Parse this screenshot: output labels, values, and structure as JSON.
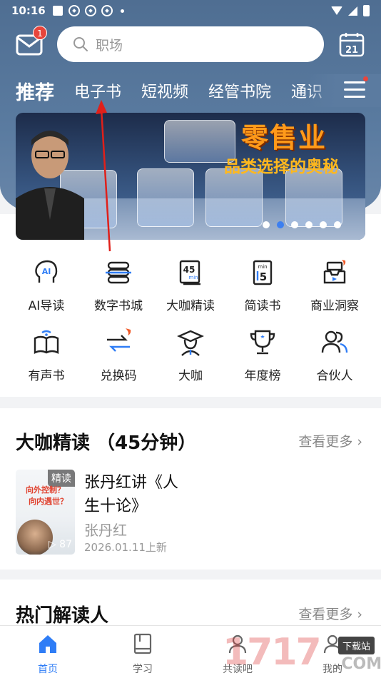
{
  "status_bar": {
    "time": "10:16"
  },
  "mail": {
    "badge_count": "1"
  },
  "search": {
    "placeholder": "职场"
  },
  "calendar": {
    "day": "21"
  },
  "tabs": [
    {
      "label": "推荐"
    },
    {
      "label": "电子书"
    },
    {
      "label": "短视频"
    },
    {
      "label": "经管书院"
    },
    {
      "label": "通识"
    }
  ],
  "banner": {
    "title_main": "零售业",
    "title_sub": "品类选择的奥秘",
    "slide_count": 6,
    "active_slide": 2
  },
  "quick_grid": [
    {
      "label": "AI导读",
      "icon": "ai-head-icon"
    },
    {
      "label": "数字书城",
      "icon": "bookshelf-icon"
    },
    {
      "label": "大咖精读",
      "icon": "45min-book-icon"
    },
    {
      "label": "简读书",
      "icon": "15min-book-icon"
    },
    {
      "label": "商业洞察",
      "icon": "insight-inbox-icon"
    },
    {
      "label": "有声书",
      "icon": "audio-book-icon"
    },
    {
      "label": "兑换码",
      "icon": "exchange-icon"
    },
    {
      "label": "大咖",
      "icon": "graduate-icon"
    },
    {
      "label": "年度榜",
      "icon": "trophy-icon"
    },
    {
      "label": "合伙人",
      "icon": "partners-icon"
    }
  ],
  "section_featured": {
    "title": "大咖精读 （45分钟）",
    "more": "查看更多",
    "book": {
      "badge": "精读",
      "cover_line1": "向外控制？",
      "cover_line2": "向内遇世？",
      "play_count": "▷ 87",
      "title": "张丹红讲《人生十论》",
      "author": "张丹红",
      "date": "2026.01.11上新"
    }
  },
  "section_readers": {
    "title": "热门解读人",
    "more": "查看更多"
  },
  "bottom_nav": [
    {
      "label": "首页",
      "active": true
    },
    {
      "label": "学习",
      "active": false
    },
    {
      "label": "共读吧",
      "active": false
    },
    {
      "label": "我的",
      "active": false
    }
  ],
  "watermark": {
    "text": "1717",
    "tag": "下载站",
    "suffix": ".COM"
  },
  "colors": {
    "header": "#5676a0",
    "accent": "#2f7df6",
    "badge": "#e8453c"
  }
}
